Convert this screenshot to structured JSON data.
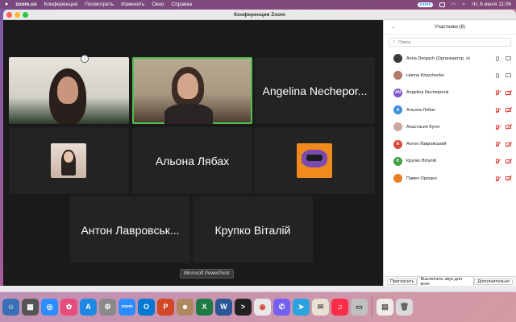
{
  "menubar": {
    "app_name": "zoom.us",
    "items": [
      "Конференция",
      "Посмотреть",
      "Изменить",
      "Окно",
      "Справка"
    ],
    "zoom_badge": "zoom",
    "datetime": "Чт, 6 июля  11:06"
  },
  "window": {
    "title": "Конференция Zoom"
  },
  "gallery": {
    "tiles": [
      {
        "name": ""
      },
      {
        "name": ""
      },
      {
        "name": "Angelina Nechepor..."
      },
      {
        "name": ""
      },
      {
        "name": "Альона Лябах"
      },
      {
        "name": ""
      },
      {
        "name": "Антон Лавровськ..."
      },
      {
        "name": "Крупко Віталій"
      }
    ],
    "share_label": "Microsoft PowerPoint"
  },
  "participants": {
    "header": "Участники (8)",
    "search_placeholder": "Поиск",
    "list": [
      {
        "name": "Anna Dergach (Организатор, я)",
        "avatar_color": "#3a3a3a",
        "initials": "",
        "muted": false,
        "video_off": false
      },
      {
        "name": "Hanna Kharchenko",
        "avatar_color": "#b07a6a",
        "initials": "",
        "muted": false,
        "video_off": false
      },
      {
        "name": "Angelina Necheporuk",
        "avatar_color": "#7e57c2",
        "initials": "AN",
        "muted": true,
        "video_off": true
      },
      {
        "name": "Альона Лябах",
        "avatar_color": "#3d8fd9",
        "initials": "А",
        "muted": true,
        "video_off": true
      },
      {
        "name": "Анастасия Кугот",
        "avatar_color": "#c9a79a",
        "initials": "",
        "muted": true,
        "video_off": true
      },
      {
        "name": "Антон Лавровський",
        "avatar_color": "#d84a3a",
        "initials": "А",
        "muted": true,
        "video_off": true
      },
      {
        "name": "Крупко Віталій",
        "avatar_color": "#43a047",
        "initials": "К",
        "muted": true,
        "video_off": true
      },
      {
        "name": "Павел Орешко",
        "avatar_color": "#e67e22",
        "initials": "",
        "muted": true,
        "video_off": true
      }
    ],
    "footer": {
      "invite": "Пригласить",
      "mute_all": "Выключить звук для всех",
      "more": "Дополнительно"
    }
  },
  "dock": {
    "zoom_label": "zoom"
  }
}
